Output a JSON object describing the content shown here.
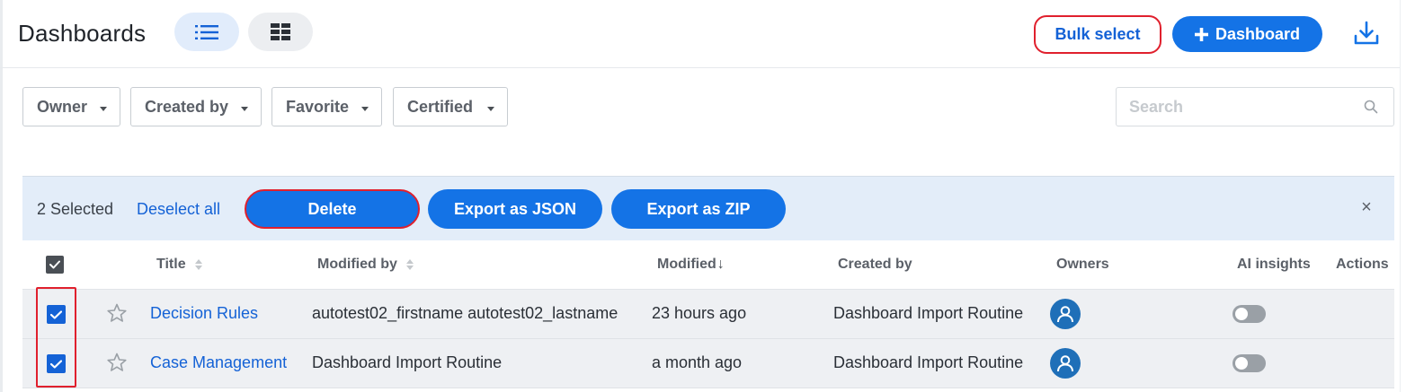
{
  "header": {
    "title": "Dashboards",
    "bulk_select_label": "Bulk select",
    "add_dashboard_label": "Dashboard"
  },
  "filters": [
    {
      "label": "Owner"
    },
    {
      "label": "Created by"
    },
    {
      "label": "Favorite"
    },
    {
      "label": "Certified"
    }
  ],
  "search": {
    "placeholder": "Search",
    "value": ""
  },
  "bulk_bar": {
    "selected_text": "2 Selected",
    "deselect_label": "Deselect all",
    "delete_label": "Delete",
    "export_json_label": "Export as JSON",
    "export_zip_label": "Export as ZIP",
    "close_glyph": "×"
  },
  "table": {
    "columns": {
      "title": "Title",
      "modified_by": "Modified by",
      "modified": "Modified",
      "modified_sort_glyph": "↓",
      "created_by": "Created by",
      "owners": "Owners",
      "ai_insights": "AI insights",
      "actions": "Actions"
    },
    "rows": [
      {
        "selected": true,
        "favorite": false,
        "title": "Decision Rules",
        "modified_by": "autotest02_firstname autotest02_lastname",
        "modified": "23 hours ago",
        "created_by": "Dashboard Import Routine",
        "ai_insights": false
      },
      {
        "selected": true,
        "favorite": false,
        "title": "Case Management",
        "modified_by": "Dashboard Import Routine",
        "modified": "a month ago",
        "created_by": "Dashboard Import Routine",
        "ai_insights": false
      }
    ]
  },
  "colors": {
    "accent": "#1473e6",
    "link": "#1462d6",
    "highlight": "#e0202d",
    "bulk_bar_bg": "#e3edf9"
  },
  "icons": {
    "list_view": "list-icon",
    "grid_view": "grid-icon",
    "plus": "plus-icon",
    "download": "download-icon",
    "search": "search-icon",
    "star": "star-icon",
    "avatar": "user-avatar-icon",
    "check": "check-icon",
    "close": "close-icon"
  }
}
